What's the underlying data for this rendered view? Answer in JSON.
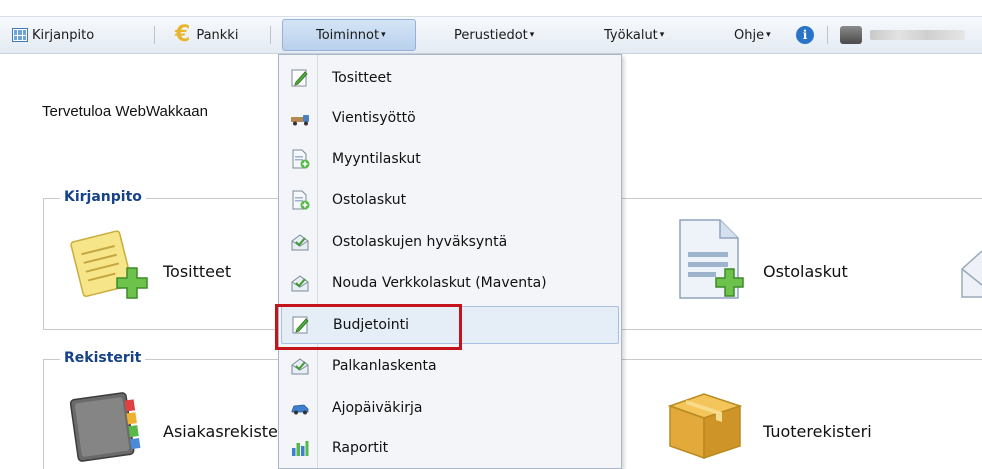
{
  "toolbar": {
    "kirjanpito": "Kirjanpito",
    "pankki": "Pankki",
    "toiminnot": "Toiminnot",
    "perustiedot": "Perustiedot",
    "tyokalut": "Työkalut",
    "ohje": "Ohje",
    "caret": "▾",
    "info_glyph": "i"
  },
  "welcome": "Tervetuloa WebWakkaan",
  "panels": {
    "kirjanpito": {
      "legend": "Kirjanpito",
      "tiles": {
        "tositteet": "Tositteet",
        "ostolaskut": "Ostolaskut"
      }
    },
    "rekisterit": {
      "legend": "Rekisterit",
      "tiles": {
        "asiakasrekisteri": "Asiakasrekisteri",
        "tuoterekisteri": "Tuoterekisteri"
      }
    }
  },
  "menu": {
    "items": [
      {
        "label": "Tositteet",
        "icon": "edit-document-icon"
      },
      {
        "label": "Vientisyöttö",
        "icon": "truck-icon"
      },
      {
        "label": "Myyntilaskut",
        "icon": "add-document-icon"
      },
      {
        "label": "Ostolaskut",
        "icon": "add-document-icon"
      },
      {
        "label": "Ostolaskujen hyväksyntä",
        "icon": "mail-approve-icon"
      },
      {
        "label": "Nouda Verkkolaskut (Maventa)",
        "icon": "mail-approve-icon"
      },
      {
        "label": "Budjetointi",
        "icon": "edit-document-icon"
      },
      {
        "label": "Palkanlaskenta",
        "icon": "mail-approve-icon"
      },
      {
        "label": "Ajopäiväkirja",
        "icon": "car-icon"
      },
      {
        "label": "Raportit",
        "icon": "bar-chart-icon"
      }
    ],
    "highlighted_item": "Budjetointi"
  },
  "colors": {
    "accent": "#15428b",
    "highlight_border": "#c3141c",
    "hover_bg": "#e5edf7"
  }
}
